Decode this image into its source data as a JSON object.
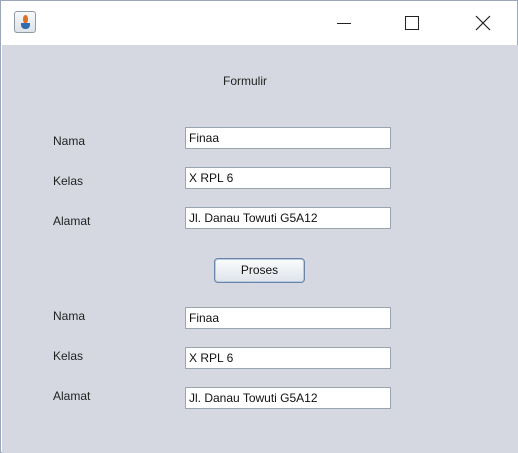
{
  "window": {
    "icon": "java-cup-icon",
    "controls": [
      "minimize-icon",
      "maximize-icon",
      "close-icon"
    ]
  },
  "form": {
    "title": "Formulir",
    "input": {
      "nama_label": "Nama",
      "nama_value": "Finaa",
      "kelas_label": "Kelas",
      "kelas_value": "X RPL 6",
      "alamat_label": "Alamat",
      "alamat_value": "Jl. Danau Towuti G5A12"
    },
    "button_label": "Proses",
    "output": {
      "nama_label": "Nama",
      "nama_value": "Finaa",
      "kelas_label": "Kelas",
      "kelas_value": "X RPL 6",
      "alamat_label": "Alamat",
      "alamat_value": "Jl. Danau Towuti G5A12"
    }
  },
  "colors": {
    "client_background": "#d5d8e0",
    "button_border": "#6a83a8"
  }
}
